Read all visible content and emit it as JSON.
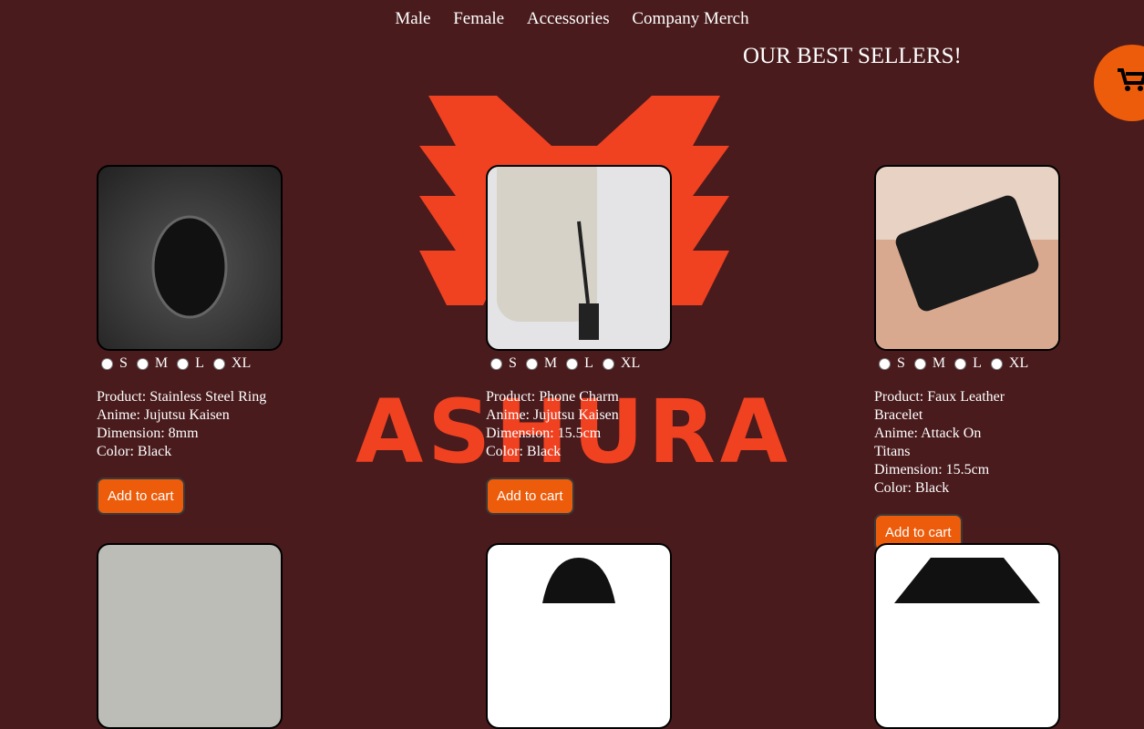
{
  "nav": [
    "Male",
    "Female",
    "Accessories",
    "Company Merch"
  ],
  "title": "OUR BEST SELLERS!",
  "logo_text": "ASHURA",
  "sizes": [
    "S",
    "M",
    "L",
    "XL"
  ],
  "add_label": "Add to cart",
  "products": [
    {
      "lines": [
        "Product: Stainless Steel Ring",
        "Anime: Jujutsu Kaisen",
        "Dimension: 8mm",
        "Color: Black"
      ]
    },
    {
      "lines": [
        "Product: Phone Charm",
        "Anime: Jujutsu Kaisen",
        "Dimension: 15.5cm",
        "Color: Black"
      ]
    },
    {
      "lines": [
        "Product: Faux Leather Bracelet",
        "Anime: Attack On Titans",
        "Dimension: 15.5cm",
        "Color: Black"
      ]
    }
  ]
}
